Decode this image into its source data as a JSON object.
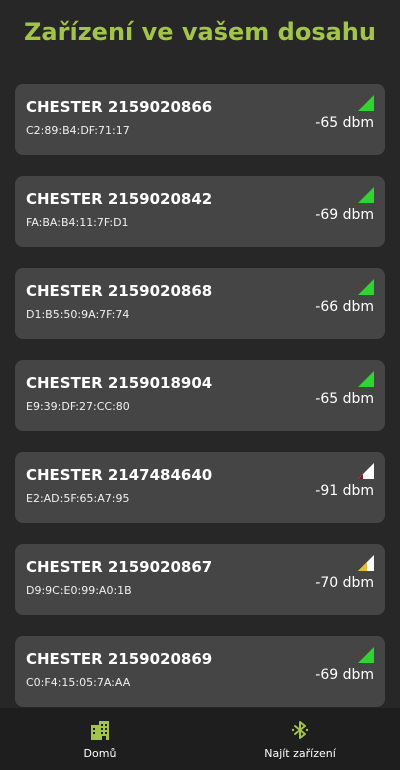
{
  "header": {
    "title": "Zařízení ve vašem dosahu"
  },
  "colors": {
    "accent": "#a2c549",
    "signal_good": "#2fd42f",
    "signal_medium": "#e6b93a",
    "signal_bad": "#8b1a1a",
    "signal_empty": "#ffffff",
    "card_bg": "#454545",
    "page_bg": "#272727"
  },
  "devices": [
    {
      "name": "CHESTER 2159020866",
      "mac": "C2:89:B4:DF:71:17",
      "signal": "-65 dbm",
      "level": "good"
    },
    {
      "name": "CHESTER 2159020842",
      "mac": "FA:BA:B4:11:7F:D1",
      "signal": "-69 dbm",
      "level": "good"
    },
    {
      "name": "CHESTER 2159020868",
      "mac": "D1:B5:50:9A:7F:74",
      "signal": "-66 dbm",
      "level": "good"
    },
    {
      "name": "CHESTER 2159018904",
      "mac": "E9:39:DF:27:CC:80",
      "signal": "-65 dbm",
      "level": "good"
    },
    {
      "name": "CHESTER 2147484640",
      "mac": "E2:AD:5F:65:A7:95",
      "signal": "-91 dbm",
      "level": "bad"
    },
    {
      "name": "CHESTER 2159020867",
      "mac": "D9:9C:E0:99:A0:1B",
      "signal": "-70 dbm",
      "level": "medium"
    },
    {
      "name": "CHESTER 2159020869",
      "mac": "C0:F4:15:05:7A:AA",
      "signal": "-69 dbm",
      "level": "good"
    }
  ],
  "nav": {
    "items": [
      {
        "label": "Domů",
        "icon": "buildings-icon"
      },
      {
        "label": "Najít zařízení",
        "icon": "bluetooth-icon"
      }
    ]
  }
}
